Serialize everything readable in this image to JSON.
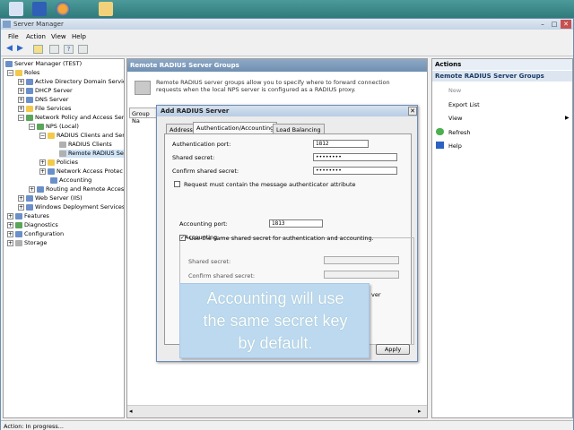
{
  "window": {
    "title": "Server Manager",
    "menu": [
      "File",
      "Action",
      "View",
      "Help"
    ],
    "controls": {
      "minimize": "–",
      "maximize": "□",
      "close": "✕"
    }
  },
  "tree": {
    "items": [
      {
        "label": "Server Manager (TEST)",
        "icon": "server-icon"
      },
      {
        "label": "Roles",
        "icon": "folder-icon"
      },
      {
        "label": "Active Directory Domain Servic",
        "icon": "ad-icon"
      },
      {
        "label": "DHCP Server",
        "icon": "dhcp-icon"
      },
      {
        "label": "DNS Server",
        "icon": "dns-icon"
      },
      {
        "label": "File Services",
        "icon": "file-icon"
      },
      {
        "label": "Network Policy and Access Serv",
        "icon": "npas-icon"
      },
      {
        "label": "NPS (Local)",
        "icon": "nps-icon"
      },
      {
        "label": "RADIUS Clients and Ser",
        "icon": "folder-icon"
      },
      {
        "label": "RADIUS Clients",
        "icon": "clients-icon"
      },
      {
        "label": "Remote RADIUS Se",
        "icon": "remote-icon"
      },
      {
        "label": "Policies",
        "icon": "folder-icon"
      },
      {
        "label": "Network Access Protec",
        "icon": "nap-icon"
      },
      {
        "label": "Accounting",
        "icon": "accounting-icon"
      },
      {
        "label": "Routing and Remote Access",
        "icon": "routing-icon"
      },
      {
        "label": "Web Server (IIS)",
        "icon": "iis-icon"
      },
      {
        "label": "Windows Deployment Services",
        "icon": "wds-icon"
      },
      {
        "label": "Features",
        "icon": "features-icon"
      },
      {
        "label": "Diagnostics",
        "icon": "diagnostics-icon"
      },
      {
        "label": "Configuration",
        "icon": "config-icon"
      },
      {
        "label": "Storage",
        "icon": "storage-icon"
      }
    ]
  },
  "center": {
    "header": "Remote RADIUS Server Groups",
    "description": "Remote RADIUS server groups allow you to specify where to forward connection requests when the local NPS server is configured as a RADIUS proxy.",
    "group_tab": "Group Na"
  },
  "actions": {
    "header": "Actions",
    "subheader": "Remote RADIUS Server Groups",
    "items": [
      {
        "label": "New",
        "enabled": false
      },
      {
        "label": "Export List",
        "enabled": true
      },
      {
        "label": "View",
        "enabled": true
      },
      {
        "label": "Refresh",
        "enabled": true
      },
      {
        "label": "Help",
        "enabled": true
      }
    ]
  },
  "status": "Action:  In progress...",
  "dialog": {
    "title": "Add RADIUS Server",
    "tabs": [
      "Address",
      "Authentication/Accounting",
      "Load Balancing"
    ],
    "active_tab": "Authentication/Accounting",
    "auth_port_label": "Authentication port:",
    "auth_port_value": "1812",
    "shared_secret_label": "Shared secret:",
    "shared_secret_value": "••••••••",
    "confirm_secret_label": "Confirm shared secret:",
    "confirm_secret_value": "••••••••",
    "msg_auth_label": "Request must contain the message authenticator attribute",
    "msg_auth_checked": false,
    "accounting_group": "Accounting",
    "acct_port_label": "Accounting port:",
    "acct_port_value": "1813",
    "same_secret_label": "Use the same shared secret for authentication and accounting.",
    "same_secret_checked": true,
    "acct_secret_label": "Shared secret:",
    "acct_confirm_label": "Confirm shared secret:",
    "forward_partial": "ver",
    "apply_button": "Apply"
  },
  "callout": {
    "lines": [
      "Accounting will use",
      "the same secret key",
      "by default."
    ]
  },
  "colors": {
    "desktop": "#3a8a8a",
    "callout_bg": "#bcd9f0",
    "header_blue": "#6f8fb2"
  }
}
